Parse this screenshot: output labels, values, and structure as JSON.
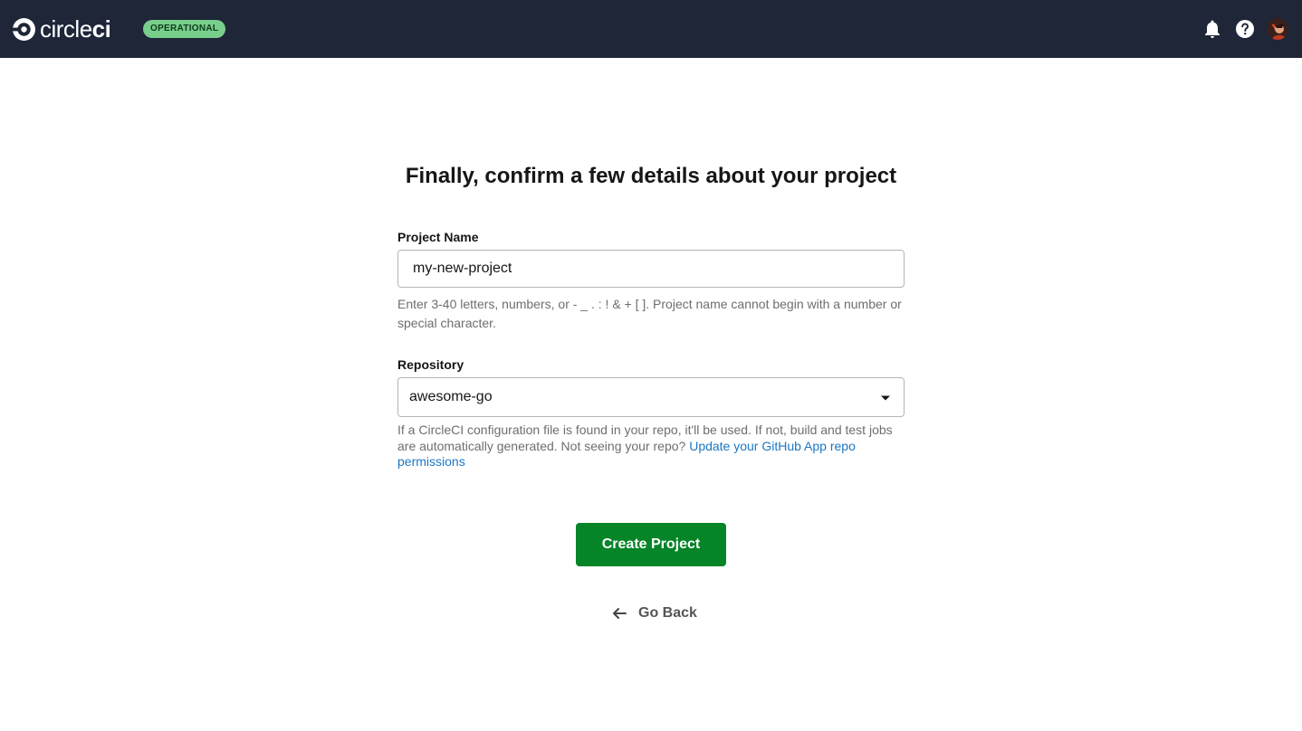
{
  "header": {
    "logo_text_light": "circle",
    "logo_text_bold": "ci",
    "status_badge": "OPERATIONAL",
    "icons": [
      "bell-icon",
      "help-icon",
      "avatar"
    ],
    "colors": {
      "background": "#1e2638",
      "badge": "#78cf8b"
    }
  },
  "main": {
    "title": "Finally, confirm a few details about your project",
    "project_name": {
      "label": "Project Name",
      "value": "my-new-project",
      "helper": "Enter 3-40 letters, numbers, or - _ . : ! & + [ ]. Project name cannot begin with a number or special character."
    },
    "repository": {
      "label": "Repository",
      "selected": "awesome-go",
      "helper": "If a CircleCI configuration file is found in your repo, it'll be used. If not, build and test jobs are automatically generated. Not seeing your repo?",
      "link": "Update your GitHub App repo permissions"
    },
    "create_button": "Create Project",
    "go_back": "Go Back",
    "colors": {
      "primary_button": "#058527",
      "link": "#1c77c3"
    }
  }
}
